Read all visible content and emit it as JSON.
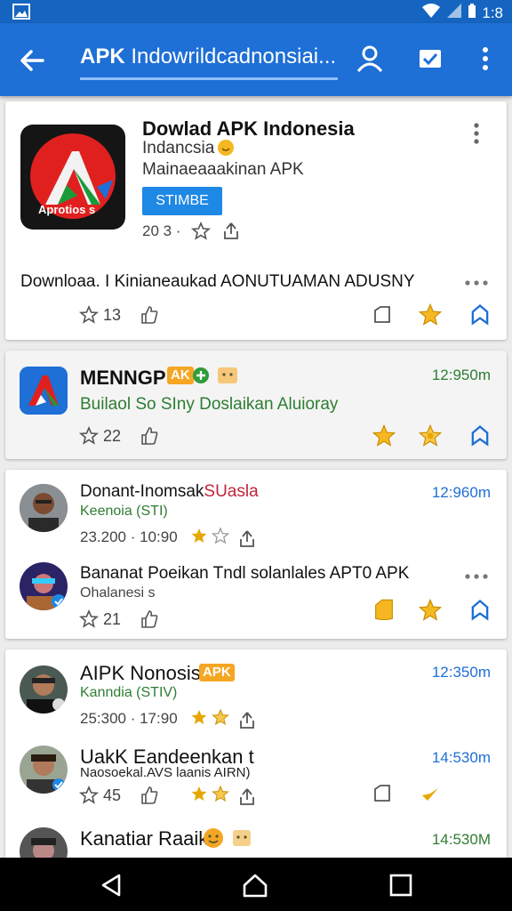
{
  "status_bar": {
    "time": "1:8"
  },
  "app_bar": {
    "title_bold": "APK",
    "title_rest": "Indowrildcadnonsiai..."
  },
  "featured": {
    "icon_text": "Aprotios s",
    "title": "Dowlad APK  Indonesia",
    "subtitle": "Indancsia",
    "publisher": "Mainaeaaakinan APK",
    "install_label": "STIMBE",
    "meta": "20 3 ·",
    "description": "Downloaa. I Kinianeaukad AONUTUAMAN ADUSNY",
    "count": "13"
  },
  "second": {
    "title": "MENNGP",
    "badge": "AK",
    "time": "12:950m",
    "subtitle": "Builaol So SIny Doslaikan Aluioray",
    "count": "22"
  },
  "comments": [
    {
      "name": "Donant-Inomsak",
      "name_suffix": "SUasla",
      "time": "12:960m",
      "sub": "Keenoia (STI)",
      "meta": "23.200 · 10:90"
    },
    {
      "name": "Bananat Poeikan Tndl solanlales APT0 APK",
      "time": "",
      "sub": "Ohalanesi s",
      "count": "21"
    }
  ],
  "comments2": [
    {
      "name": "AIPK Nonosis",
      "badge": "APK",
      "time": "12:350m",
      "sub": "Kanndia (STIV)",
      "meta": "25:300 · 17:90"
    },
    {
      "name": "UakK Eandeenkan t",
      "time": "14:530m",
      "sub": "Naosoekal.AVS laanis AIRN)",
      "count": "45"
    },
    {
      "name": "Kanatiar Raaik",
      "time": "14:530M",
      "sub": ""
    }
  ]
}
